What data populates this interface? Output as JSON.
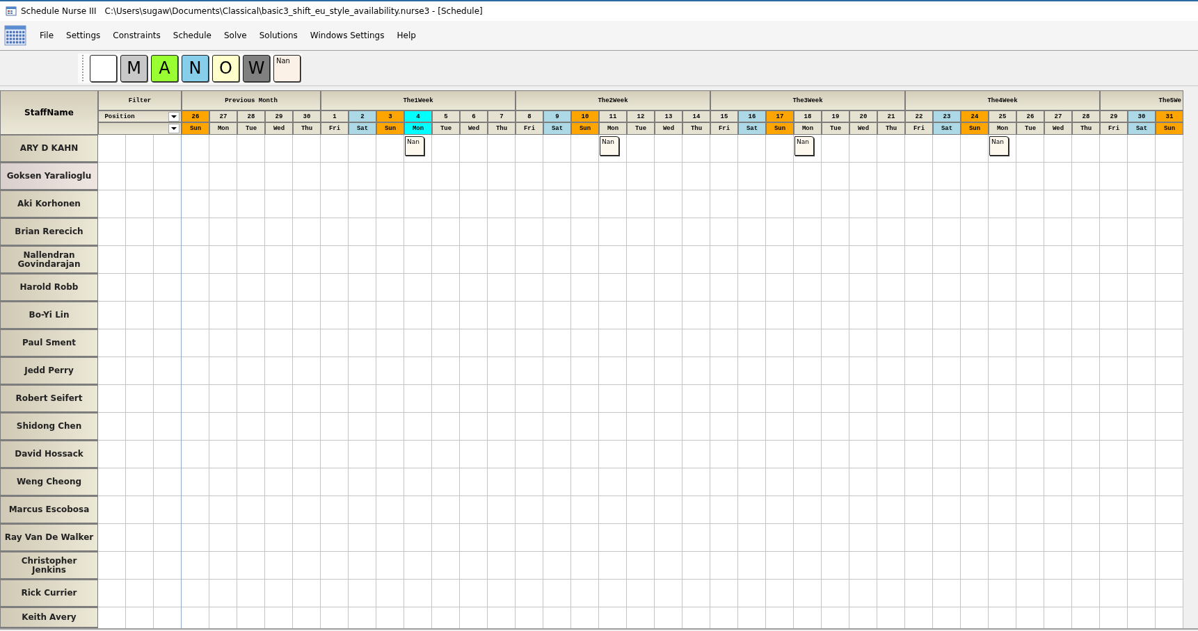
{
  "window": {
    "app_name": "Schedule Nurse III",
    "title": "C:\\Users\\sugaw\\Documents\\Classical\\basic3_shift_eu_style_availability.nurse3 - [Schedule]"
  },
  "menu": [
    "File",
    "Settings",
    "Constraints",
    "Schedule",
    "Solve",
    "Solutions",
    "Windows Settings",
    "Help"
  ],
  "shift_palette": [
    {
      "kind": "blank",
      "color": "#ffffff"
    },
    {
      "kind": "letter",
      "label": "M",
      "color": "#c8c8c8"
    },
    {
      "kind": "letter",
      "label": "A",
      "color": "#99ff33"
    },
    {
      "kind": "letter",
      "label": "N",
      "color": "#87ceeb"
    },
    {
      "kind": "letter",
      "label": "O",
      "color": "#ffffcc"
    },
    {
      "kind": "letter",
      "label": "W",
      "color": "#808080"
    },
    {
      "kind": "small",
      "label": "Nan",
      "color": "#fcf1e6"
    }
  ],
  "grid": {
    "staff_heading": "StaffName",
    "filter_heading": "Filter",
    "filter_field": {
      "value": "Position"
    },
    "weeks": [
      {
        "label": "Previous Month",
        "days": [
          {
            "date": "26",
            "weekday": "Sun",
            "color": "#ffa500"
          },
          {
            "date": "27",
            "weekday": "Mon",
            "color": "#e6e2d2"
          },
          {
            "date": "28",
            "weekday": "Tue",
            "color": "#e6e2d2"
          },
          {
            "date": "29",
            "weekday": "Wed",
            "color": "#e6e2d2"
          },
          {
            "date": "30",
            "weekday": "Thu",
            "color": "#e6e2d2"
          }
        ]
      },
      {
        "label": "The1Week",
        "days": [
          {
            "date": "1",
            "weekday": "Fri",
            "color": "#e6e2d2"
          },
          {
            "date": "2",
            "weekday": "Sat",
            "color": "#add8e6"
          },
          {
            "date": "3",
            "weekday": "Sun",
            "color": "#ffa500"
          },
          {
            "date": "4",
            "weekday": "Mon",
            "color": "#00ffff"
          },
          {
            "date": "5",
            "weekday": "Tue",
            "color": "#e6e2d2"
          },
          {
            "date": "6",
            "weekday": "Wed",
            "color": "#e6e2d2"
          },
          {
            "date": "7",
            "weekday": "Thu",
            "color": "#e6e2d2"
          }
        ]
      },
      {
        "label": "The2Week",
        "days": [
          {
            "date": "8",
            "weekday": "Fri",
            "color": "#e6e2d2"
          },
          {
            "date": "9",
            "weekday": "Sat",
            "color": "#add8e6"
          },
          {
            "date": "10",
            "weekday": "Sun",
            "color": "#ffa500"
          },
          {
            "date": "11",
            "weekday": "Mon",
            "color": "#e6e2d2"
          },
          {
            "date": "12",
            "weekday": "Tue",
            "color": "#e6e2d2"
          },
          {
            "date": "13",
            "weekday": "Wed",
            "color": "#e6e2d2"
          },
          {
            "date": "14",
            "weekday": "Thu",
            "color": "#e6e2d2"
          }
        ]
      },
      {
        "label": "The3Week",
        "days": [
          {
            "date": "15",
            "weekday": "Fri",
            "color": "#e6e2d2"
          },
          {
            "date": "16",
            "weekday": "Sat",
            "color": "#add8e6"
          },
          {
            "date": "17",
            "weekday": "Sun",
            "color": "#ffa500"
          },
          {
            "date": "18",
            "weekday": "Mon",
            "color": "#e6e2d2"
          },
          {
            "date": "19",
            "weekday": "Tue",
            "color": "#e6e2d2"
          },
          {
            "date": "20",
            "weekday": "Wed",
            "color": "#e6e2d2"
          },
          {
            "date": "21",
            "weekday": "Thu",
            "color": "#e6e2d2"
          }
        ]
      },
      {
        "label": "The4Week",
        "days": [
          {
            "date": "22",
            "weekday": "Fri",
            "color": "#e6e2d2"
          },
          {
            "date": "23",
            "weekday": "Sat",
            "color": "#add8e6"
          },
          {
            "date": "24",
            "weekday": "Sun",
            "color": "#ffa500"
          },
          {
            "date": "25",
            "weekday": "Mon",
            "color": "#e6e2d2"
          },
          {
            "date": "26",
            "weekday": "Tue",
            "color": "#e6e2d2"
          },
          {
            "date": "27",
            "weekday": "Wed",
            "color": "#e6e2d2"
          },
          {
            "date": "28",
            "weekday": "Thu",
            "color": "#e6e2d2"
          }
        ]
      },
      {
        "label": "The5We",
        "days": [
          {
            "date": "29",
            "weekday": "Fri",
            "color": "#e6e2d2"
          },
          {
            "date": "30",
            "weekday": "Sat",
            "color": "#add8e6"
          },
          {
            "date": "31",
            "weekday": "Sun",
            "color": "#ffa500"
          }
        ]
      }
    ],
    "staff": [
      {
        "name": "ARY D KAHN",
        "selected": false,
        "shifts": [
          {
            "kind": "empty"
          },
          {
            "kind": "empty"
          },
          {
            "kind": "empty"
          },
          {
            "kind": "empty"
          },
          {
            "kind": "empty"
          },
          {
            "kind": "empty"
          },
          {
            "kind": "empty"
          },
          {
            "kind": "empty"
          },
          {
            "kind": "shift",
            "label": "Nan"
          },
          {
            "kind": "empty"
          },
          {
            "kind": "empty"
          },
          {
            "kind": "empty"
          },
          {
            "kind": "empty"
          },
          {
            "kind": "empty"
          },
          {
            "kind": "empty"
          },
          {
            "kind": "shift",
            "label": "Nan"
          },
          {
            "kind": "empty"
          },
          {
            "kind": "empty"
          },
          {
            "kind": "empty"
          },
          {
            "kind": "empty"
          },
          {
            "kind": "empty"
          },
          {
            "kind": "empty"
          },
          {
            "kind": "shift",
            "label": "Nan"
          },
          {
            "kind": "empty"
          },
          {
            "kind": "empty"
          },
          {
            "kind": "empty"
          },
          {
            "kind": "empty"
          },
          {
            "kind": "empty"
          },
          {
            "kind": "empty"
          },
          {
            "kind": "shift",
            "label": "Nan"
          },
          {
            "kind": "empty"
          },
          {
            "kind": "empty"
          },
          {
            "kind": "empty"
          },
          {
            "kind": "empty"
          },
          {
            "kind": "empty"
          },
          {
            "kind": "empty"
          }
        ]
      },
      {
        "name": "Goksen Yaralioglu",
        "selected": true
      },
      {
        "name": "Aki Korhonen",
        "selected": false
      },
      {
        "name": "Brian Rerecich",
        "selected": false
      },
      {
        "name": "Nallendran Govindarajan",
        "selected": false
      },
      {
        "name": "Harold Robb",
        "selected": false
      },
      {
        "name": "Bo-Yi Lin",
        "selected": false
      },
      {
        "name": "Paul Sment",
        "selected": false
      },
      {
        "name": "Jedd Perry",
        "selected": false
      },
      {
        "name": "Robert Seifert",
        "selected": false
      },
      {
        "name": "Shidong Chen",
        "selected": false
      },
      {
        "name": "David Hossack",
        "selected": false
      },
      {
        "name": "Weng Cheong",
        "selected": false
      },
      {
        "name": "Marcus Escobosa",
        "selected": false
      },
      {
        "name": "Ray Van De Walker",
        "selected": false
      },
      {
        "name": "Christopher Jenkins",
        "selected": false
      },
      {
        "name": "Rick Currier",
        "selected": false
      },
      {
        "name": "Keith Avery",
        "selected": false
      }
    ]
  }
}
